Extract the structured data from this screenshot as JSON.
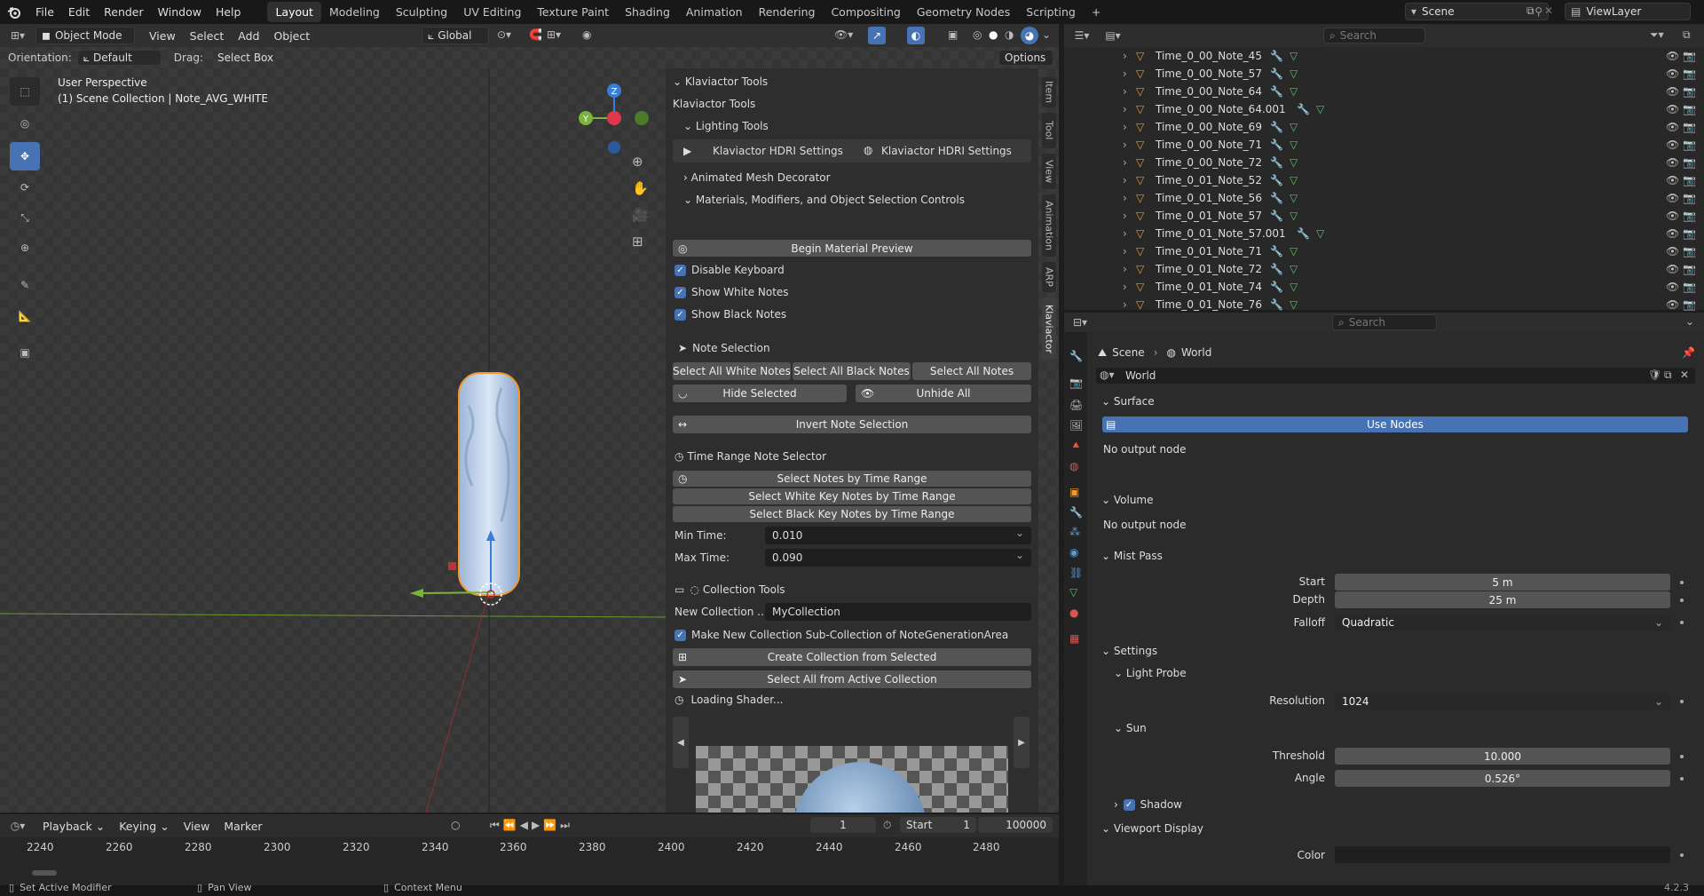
{
  "topbar": {
    "menus": [
      "File",
      "Edit",
      "Render",
      "Window",
      "Help"
    ],
    "workspaces": [
      "Layout",
      "Modeling",
      "Sculpting",
      "UV Editing",
      "Texture Paint",
      "Shading",
      "Animation",
      "Rendering",
      "Compositing",
      "Geometry Nodes",
      "Scripting"
    ],
    "active_workspace": "Layout",
    "scene": "Scene",
    "view_layer": "ViewLayer"
  },
  "viewport": {
    "mode": "Object Mode",
    "menus": [
      "View",
      "Select",
      "Add",
      "Object"
    ],
    "transform": "Global",
    "options": "Options",
    "orientation_label": "Orientation:",
    "orientation_value": "Default",
    "drag_label": "Drag:",
    "drag_value": "Select Box",
    "overlay_title": "User Perspective",
    "overlay_sub": "(1) Scene Collection | Note_AVG_WHITE",
    "gizmo": {
      "x": "X",
      "y": "Y",
      "z": "Z"
    }
  },
  "npanel": {
    "header": "Klaviactor Tools",
    "subtitle": "Klaviactor Tools",
    "lighting": "Lighting Tools",
    "hdri1": "Klaviactor HDRI Settings",
    "hdri2": "Klaviactor HDRI Settings",
    "anim_mesh": "Animated Mesh Decorator",
    "materials": "Materials, Modifiers, and Object Selection Controls",
    "begin_preview": "Begin Material Preview",
    "disable_kb": "Disable Keyboard",
    "show_white": "Show White Notes",
    "show_black": "Show Black Notes",
    "note_selection": "Note Selection",
    "sel_white": "Select All White Notes",
    "sel_black": "Select All Black Notes",
    "sel_all": "Select All Notes",
    "hide_sel": "Hide Selected",
    "unhide_all": "Unhide All",
    "invert": "Invert Note Selection",
    "time_range": "Time Range Note Selector",
    "sel_time": "Select Notes by Time Range",
    "sel_white_time": "Select White Key Notes by Time Range",
    "sel_black_time": "Select Black Key Notes by Time Range",
    "min_time_label": "Min Time:",
    "min_time": "0.010",
    "max_time_label": "Max Time:",
    "max_time": "0.090",
    "collection_tools": "Collection Tools",
    "new_coll_label": "New Collection ...",
    "new_coll_value": "MyCollection",
    "make_sub": "Make New Collection Sub-Collection of NoteGenerationArea",
    "create_coll": "Create Collection from Selected",
    "select_active": "Select All from Active Collection",
    "loading": "Loading Shader...",
    "tabs": [
      "Item",
      "Tool",
      "View",
      "Animation",
      "ARP",
      "Klaviactor"
    ]
  },
  "timeline": {
    "menus": [
      "Playback",
      "Keying",
      "View",
      "Marker"
    ],
    "current_frame": "1",
    "start_label": "Start",
    "start": "1",
    "end": "100000",
    "ticks": [
      "2240",
      "2260",
      "2280",
      "2300",
      "2320",
      "2340",
      "2360",
      "2380",
      "2400",
      "2420",
      "2440",
      "2460",
      "2480"
    ]
  },
  "outliner": {
    "search": "Search",
    "items": [
      "Time_0_00_Note_45",
      "Time_0_00_Note_57",
      "Time_0_00_Note_64",
      "Time_0_00_Note_64.001",
      "Time_0_00_Note_69",
      "Time_0_00_Note_71",
      "Time_0_00_Note_72",
      "Time_0_01_Note_52",
      "Time_0_01_Note_56",
      "Time_0_01_Note_57",
      "Time_0_01_Note_57.001",
      "Time_0_01_Note_71",
      "Time_0_01_Note_72",
      "Time_0_01_Note_74",
      "Time_0_01_Note_76"
    ]
  },
  "properties": {
    "search": "Search",
    "breadcrumb_scene": "Scene",
    "breadcrumb_world": "World",
    "world_name": "World",
    "surface": "Surface",
    "use_nodes": "Use Nodes",
    "no_output1": "No output node",
    "volume": "Volume",
    "no_output2": "No output node",
    "mist": "Mist Pass",
    "start_label": "Start",
    "start": "5 m",
    "depth_label": "Depth",
    "depth": "25 m",
    "falloff_label": "Falloff",
    "falloff": "Quadratic",
    "settings": "Settings",
    "light_probe": "Light Probe",
    "resolution_label": "Resolution",
    "resolution": "1024",
    "sun": "Sun",
    "threshold_label": "Threshold",
    "threshold": "10.000",
    "angle_label": "Angle",
    "angle": "0.526°",
    "shadow": "Shadow",
    "viewport_display": "Viewport Display",
    "color_label": "Color"
  },
  "status": {
    "left": "Set Active Modifier",
    "mid": "Pan View",
    "right": "Context Menu",
    "version": "4.2.3"
  },
  "colors": {
    "accent": "#4772b3",
    "gizmo_x": "#e0384b",
    "gizmo_y": "#79b43e",
    "gizmo_z": "#3a7ed6",
    "selected": "#f09a2e"
  }
}
